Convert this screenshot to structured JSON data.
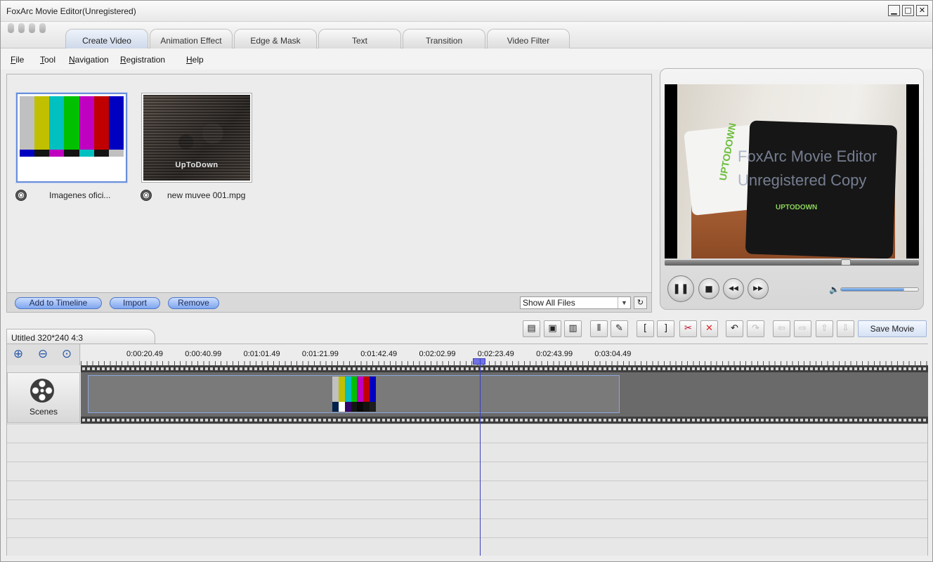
{
  "window": {
    "title": "FoxArc Movie Editor(Unregistered)",
    "controls": {
      "minimize": "▁",
      "maximize": "□",
      "close": "✕"
    }
  },
  "tabs": [
    {
      "label": "Create Video",
      "active": true
    },
    {
      "label": "Animation Effect",
      "active": false
    },
    {
      "label": "Edge & Mask",
      "active": false
    },
    {
      "label": "Text",
      "active": false
    },
    {
      "label": "Transition",
      "active": false
    },
    {
      "label": "Video Filter",
      "active": false
    }
  ],
  "menu": [
    "File",
    "Tool",
    "Navigation",
    "Registration",
    "Help"
  ],
  "library": {
    "items": [
      {
        "caption": "Imagenes ofici...",
        "kind": "color-bars",
        "selected": true
      },
      {
        "caption": "new muvee 001.mpg",
        "kind": "video",
        "overlay_text": "UpToDown",
        "selected": false
      }
    ],
    "buttons": {
      "add": "Add to Timeline",
      "import": "Import",
      "remove": "Remove"
    },
    "filter": {
      "selected": "Show All Files",
      "arrow": "▼",
      "refresh": "↻"
    }
  },
  "preview": {
    "watermark_line1": "FoxArc Movie Editor",
    "watermark_line2": "Unregistered Copy",
    "shirt_text": "UPTODOWN",
    "shirt_logo": "UPTODOWN",
    "seek_position": 0.72,
    "volume": 0.82,
    "controls": {
      "pause": "❚❚",
      "stop": "■",
      "rewind": "◀◀",
      "forward": "▶▶",
      "volume_icon": "🔈"
    }
  },
  "project": {
    "tab_label": "Utitled 320*240 4:3",
    "toolbar": [
      {
        "name": "add-video-icon",
        "glyph": "▤"
      },
      {
        "name": "open-project-icon",
        "glyph": "▣"
      },
      {
        "name": "save-project-icon",
        "glyph": "▥"
      },
      {
        "name": "split-icon",
        "glyph": "⫴"
      },
      {
        "name": "trim-icon",
        "glyph": "✎"
      },
      {
        "name": "mark-in-icon",
        "glyph": "["
      },
      {
        "name": "mark-out-icon",
        "glyph": "]"
      },
      {
        "name": "cut-icon",
        "glyph": "✂"
      },
      {
        "name": "delete-icon",
        "glyph": "✕"
      },
      {
        "name": "undo-icon",
        "glyph": "↶"
      },
      {
        "name": "redo-icon",
        "glyph": "↷"
      },
      {
        "name": "move-left-icon",
        "glyph": "⇦"
      },
      {
        "name": "move-right-icon",
        "glyph": "⇨"
      },
      {
        "name": "move-up-icon",
        "glyph": "⇧"
      },
      {
        "name": "move-down-icon",
        "glyph": "⇩"
      }
    ],
    "save_label": "Save Movie"
  },
  "timeline": {
    "zoom": {
      "in": "⊕",
      "out": "⊖",
      "fit": "⊙"
    },
    "ruler_labels": [
      "0:00:20.49",
      "0:00:40.99",
      "0:01:01.49",
      "0:01:21.99",
      "0:01:42.49",
      "0:02:02.99",
      "0:02:23.49",
      "0:02:43.99",
      "0:03:04.49"
    ],
    "track_label": "Scenes",
    "colors": {
      "clip_border": "#8aa6dd",
      "playhead": "#3a3fbf"
    }
  },
  "colorbars": {
    "top": [
      "#c0c0c0",
      "#c0c000",
      "#00c0c0",
      "#00c000",
      "#c000c0",
      "#c00000",
      "#0000c0"
    ],
    "mid": [
      "#0000c0",
      "#131313",
      "#c000c0",
      "#131313",
      "#00c0c0",
      "#131313",
      "#c0c0c0"
    ],
    "bot": [
      "#00214c",
      "#ffffff",
      "#32006a",
      "#131313",
      "#090909",
      "#131313",
      "#1d1d1d"
    ]
  }
}
